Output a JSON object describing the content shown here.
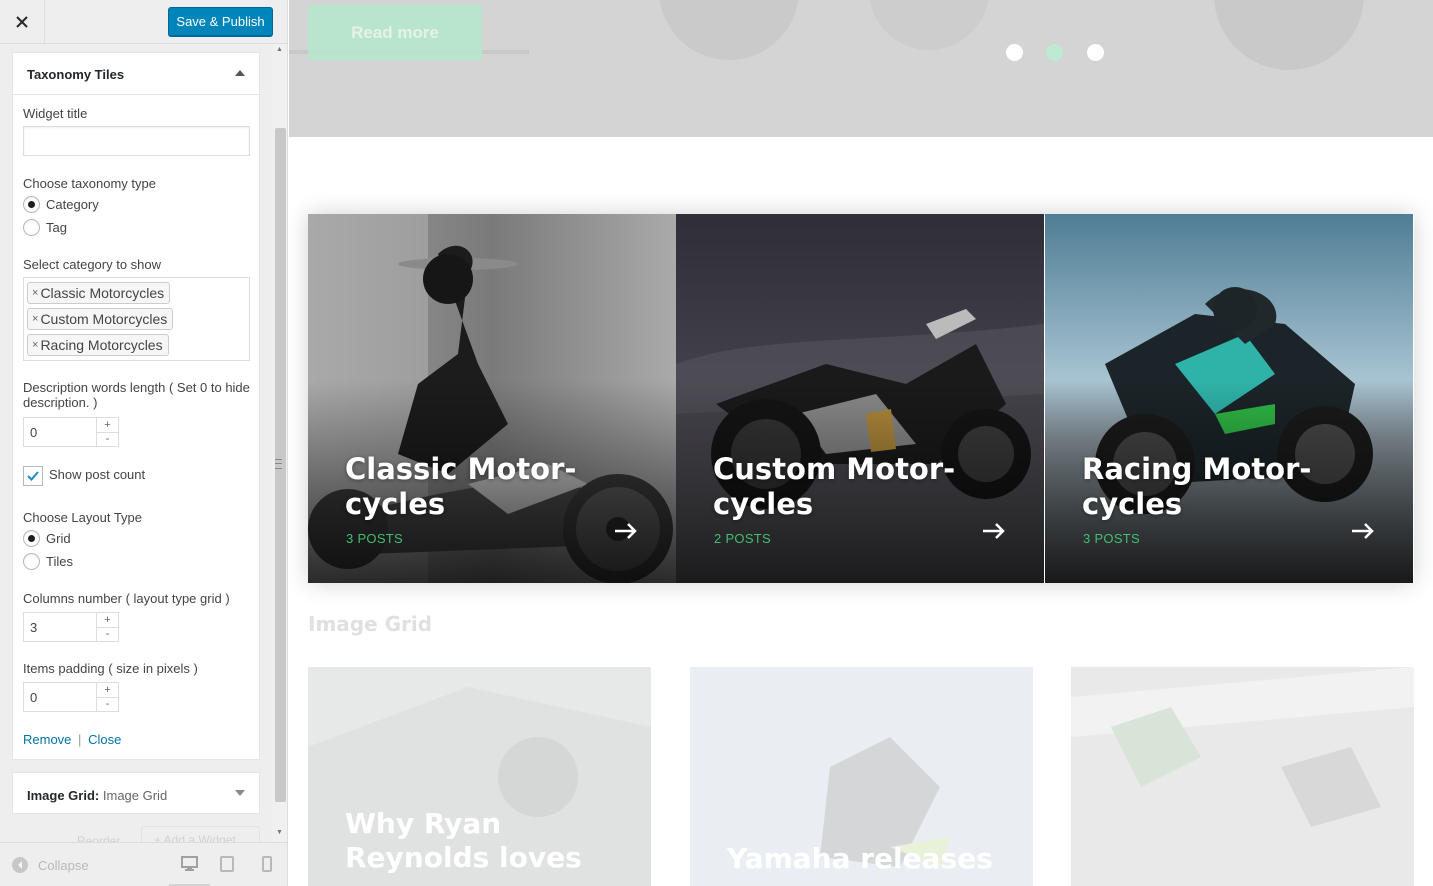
{
  "panel": {
    "save_label": "Save & Publish",
    "widget": {
      "title": "Taxonomy Tiles",
      "widget_title_label": "Widget title",
      "widget_title_value": "",
      "taxonomy_type_label": "Choose taxonomy type",
      "taxonomy_options": [
        {
          "label": "Category",
          "selected": true
        },
        {
          "label": "Tag",
          "selected": false
        }
      ],
      "category_label": "Select category to show",
      "categories": [
        "Classic Motorcycles",
        "Custom Motorcycles",
        "Racing Motorcycles"
      ],
      "tag_remove_glyph": "×",
      "desc_length_label": "Description words length ( Set 0 to hide description. )",
      "desc_length_value": "0",
      "show_post_count_label": "Show post count",
      "show_post_count_checked": true,
      "layout_type_label": "Choose Layout Type",
      "layout_options": [
        {
          "label": "Grid",
          "selected": true
        },
        {
          "label": "Tiles",
          "selected": false
        }
      ],
      "columns_label": "Columns number ( layout type grid )",
      "columns_value": "3",
      "padding_label": "Items padding ( size in pixels )",
      "padding_value": "0",
      "remove_label": "Remove",
      "separator": "|",
      "close_label": "Close"
    },
    "collapsed_widget": {
      "title": "Image Grid:",
      "subtitle": "Image Grid"
    },
    "faded_row": {
      "reorder": "Reorder",
      "add_widget": "+ Add a Widget"
    },
    "footer": {
      "collapse_label": "Collapse"
    }
  },
  "preview": {
    "read_more_label": "Read more",
    "slider_dots": [
      {
        "active": false
      },
      {
        "active": true
      },
      {
        "active": false
      }
    ],
    "tiles": [
      {
        "title_line1": "Classic Motor-",
        "title_line2": "cycles",
        "count": "3 POSTS"
      },
      {
        "title_line1": "Custom Motor-",
        "title_line2": "cycles",
        "count": "2 POSTS"
      },
      {
        "title_line1": "Racing Motor-",
        "title_line2": "cycles",
        "count": "3 POSTS"
      }
    ],
    "image_grid_heading": "Image Grid",
    "grid_cards": [
      {
        "title_line1": "Why Ryan",
        "title_line2": "Reynolds loves"
      },
      {
        "title_line1": "Yamaha releases",
        "title_line2": ""
      },
      {
        "title_line1": "",
        "title_line2": ""
      }
    ]
  },
  "colors": {
    "accent": "#0085ba",
    "link": "#0073aa",
    "post_count_green": "#3fbf74",
    "read_more_bg": "#b6e8cc"
  }
}
